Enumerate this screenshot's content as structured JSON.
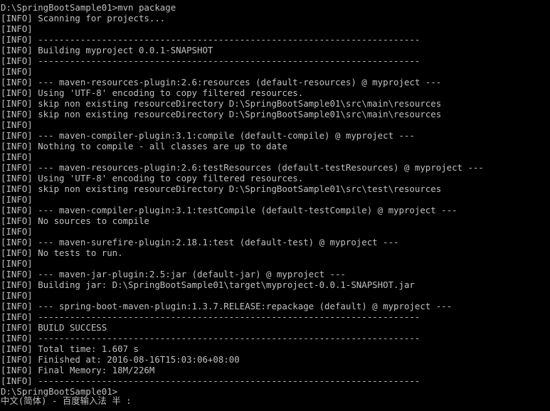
{
  "terminal": {
    "background": "#000000",
    "foreground": "#c0c0c0",
    "lines": [
      "D:\\SpringBootSample01>mvn package",
      "[INFO] Scanning for projects...",
      "[INFO]",
      "[INFO] ------------------------------------------------------------------------",
      "[INFO] Building myproject 0.0.1-SNAPSHOT",
      "[INFO] ------------------------------------------------------------------------",
      "[INFO]",
      "[INFO] --- maven-resources-plugin:2.6:resources (default-resources) @ myproject ---",
      "[INFO] Using 'UTF-8' encoding to copy filtered resources.",
      "[INFO] skip non existing resourceDirectory D:\\SpringBootSample01\\src\\main\\resources",
      "[INFO] skip non existing resourceDirectory D:\\SpringBootSample01\\src\\main\\resources",
      "[INFO]",
      "[INFO] --- maven-compiler-plugin:3.1:compile (default-compile) @ myproject ---",
      "[INFO] Nothing to compile - all classes are up to date",
      "[INFO]",
      "[INFO] --- maven-resources-plugin:2.6:testResources (default-testResources) @ myproject ---",
      "[INFO] Using 'UTF-8' encoding to copy filtered resources.",
      "[INFO] skip non existing resourceDirectory D:\\SpringBootSample01\\src\\test\\resources",
      "[INFO]",
      "[INFO] --- maven-compiler-plugin:3.1:testCompile (default-testCompile) @ myproject ---",
      "[INFO] No sources to compile",
      "[INFO]",
      "[INFO] --- maven-surefire-plugin:2.18.1:test (default-test) @ myproject ---",
      "[INFO] No tests to run.",
      "[INFO]",
      "[INFO] --- maven-jar-plugin:2.5:jar (default-jar) @ myproject ---",
      "[INFO] Building jar: D:\\SpringBootSample01\\target\\myproject-0.0.1-SNAPSHOT.jar",
      "[INFO]",
      "[INFO] --- spring-boot-maven-plugin:1.3.7.RELEASE:repackage (default) @ myproject ---",
      "[INFO] ------------------------------------------------------------------------",
      "[INFO] BUILD SUCCESS",
      "[INFO] ------------------------------------------------------------------------",
      "[INFO] Total time: 1.607 s",
      "[INFO] Finished at: 2016-08-16T15:03:06+08:00",
      "[INFO] Final Memory: 18M/226M",
      "[INFO] ------------------------------------------------------------------------",
      "D:\\SpringBootSample01>"
    ]
  },
  "ime": {
    "status": "中文(简体) - 百度输入法 半 :"
  }
}
